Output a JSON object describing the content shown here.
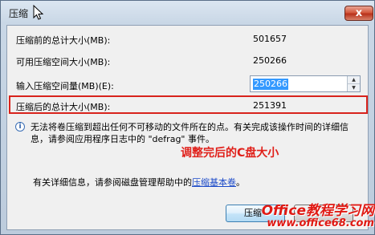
{
  "window": {
    "title": "压缩",
    "close_label": "x"
  },
  "rows": [
    {
      "label": "压缩前的总计大小(MB):",
      "value": "501657"
    },
    {
      "label": "可用压缩空间大小(MB):",
      "value": "250266"
    },
    {
      "label": "输入压缩空间量(MB)(E):",
      "value": "250266"
    },
    {
      "label": "压缩后的总计大小(MB):",
      "value": "251391"
    }
  ],
  "info": {
    "text": "无法将卷压缩到超出任何不可移动的文件所在的点。有关完成该操作时间的详细信息，请参阅应用程序日志中的 \"defrag\" 事件。"
  },
  "annotation": "调整完后的C盘大小",
  "more_info": {
    "prefix": "有关详细信息，请参阅磁盘管理帮助中的",
    "link": "压缩基本卷",
    "suffix": "。"
  },
  "buttons": {
    "compress": "压缩"
  },
  "watermark": {
    "line1": "Office教程学习网",
    "line2": "www.office68.com"
  }
}
